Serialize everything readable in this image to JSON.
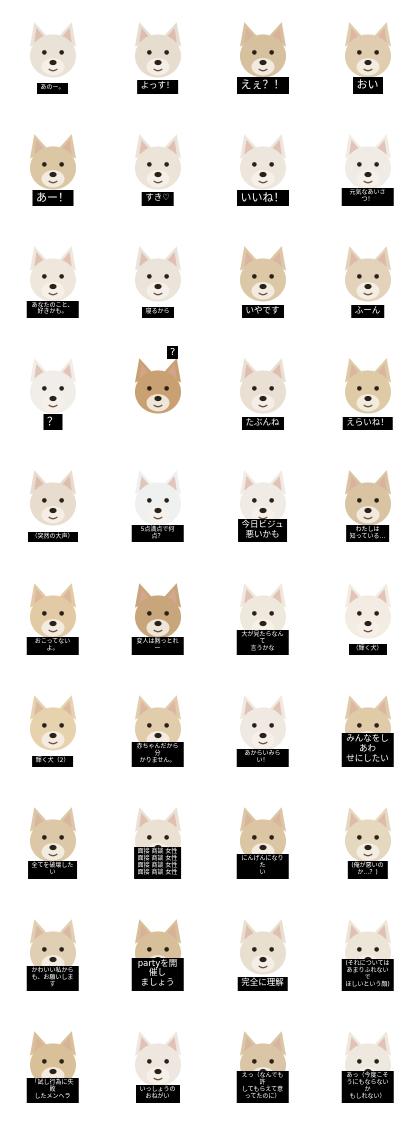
{
  "stickers": [
    {
      "caption": "あのー。",
      "size": "sm",
      "fur": "#e9e2d6"
    },
    {
      "caption": "よっす！",
      "size": "md",
      "fur": "#e7ddcf"
    },
    {
      "caption": "えぇ？！",
      "size": "lg",
      "fur": "#d7c09e"
    },
    {
      "caption": "おい",
      "size": "lg",
      "fur": "#e0cdb0"
    },
    {
      "caption": "あー！",
      "size": "lg",
      "fur": "#dcc7a4"
    },
    {
      "caption": "すき♡",
      "size": "md",
      "fur": "#ece4d8"
    },
    {
      "caption": "いいね！",
      "size": "lg",
      "fur": "#ede6dc"
    },
    {
      "caption": "元気なあいさつ！",
      "size": "sm",
      "fur": "#f0ece5"
    },
    {
      "caption": "あなたのこと、好きかも。",
      "size": "sm",
      "fur": "#efe7dc"
    },
    {
      "caption": "寝るから",
      "size": "sm",
      "fur": "#ebe4da"
    },
    {
      "caption": "いやです",
      "size": "md",
      "fur": "#dcc8a7"
    },
    {
      "caption": "ふーん",
      "size": "md",
      "fur": "#e4d3bb"
    },
    {
      "caption": "？",
      "size": "lg",
      "fur": "#f1eee9"
    },
    {
      "caption": "",
      "size": "sm",
      "fur": "#c9a072",
      "tag": "?"
    },
    {
      "caption": "たぶんね",
      "size": "md",
      "fur": "#e9dfd2"
    },
    {
      "caption": "えらいね！",
      "size": "md",
      "fur": "#dfcaa6"
    },
    {
      "caption": "（突然の大声）",
      "size": "sm",
      "fur": "#e7dccd"
    },
    {
      "caption": "5点満点で何点？",
      "size": "sm",
      "fur": "#eff0f0"
    },
    {
      "caption": "今日ビジュ\n悪いかも",
      "size": "md",
      "fur": "#f0ebe4"
    },
    {
      "caption": "わたしは\n知っている…",
      "size": "sm",
      "fur": "#d9c3a3"
    },
    {
      "caption": "おこってないよ。",
      "size": "sm",
      "fur": "#e2cba4"
    },
    {
      "caption": "変人は黙っとれー",
      "size": "sm",
      "fur": "#c8a57a"
    },
    {
      "caption": "大が見たらなんて\n言うかな",
      "size": "sm",
      "fur": "#efe8dd"
    },
    {
      "caption": "（輝く犬）",
      "size": "sm",
      "fur": "#f2ece2"
    },
    {
      "caption": "輝く犬（2）",
      "size": "sm",
      "fur": "#e7d2ae"
    },
    {
      "caption": "赤ちゃんだから 分\nかりません。",
      "size": "sm",
      "fur": "#e1ccac"
    },
    {
      "caption": "あからいみらい！",
      "size": "sm",
      "fur": "#efe9e1"
    },
    {
      "caption": "みんなをしあわ\nせにしたい",
      "size": "md",
      "fur": "#e0cba9"
    },
    {
      "caption": "全てを破壊した\nい",
      "size": "sm",
      "fur": "#dcc7a6"
    },
    {
      "caption": "面接 商談 女性\n面接 商談 女性\n面接 商談 女性\n面接 商談 女性",
      "size": "sm",
      "fur": "#ebe1d3"
    },
    {
      "caption": "にんげんになりた\nい",
      "size": "sm",
      "fur": "#dcc5a2"
    },
    {
      "caption": "(俺が悪いの\nか…？)",
      "size": "sm",
      "fur": "#e6d7bf"
    },
    {
      "caption": "かわいい私から\nも、お願いします",
      "size": "sm",
      "fur": "#e1cfb3"
    },
    {
      "caption": "partyを開催し\nましょう",
      "size": "md",
      "fur": "#d7bf99"
    },
    {
      "caption": "完全に理解",
      "size": "md",
      "fur": "#e9dfcf"
    },
    {
      "caption": "(それについては\nあまりふれないで\nほしいという顔)",
      "size": "sm",
      "fur": "#ede5d8"
    },
    {
      "caption": "「試し行為に失敗\nしたメンヘラ",
      "size": "sm",
      "fur": "#d9c099"
    },
    {
      "caption": "いっしょうの\nおねがい",
      "size": "sm",
      "fur": "#ede7df"
    },
    {
      "caption": "えっ（なんでも許\nしてもらえて意\nってたのに）",
      "size": "sm",
      "fur": "#dac6a6"
    },
    {
      "caption": "あっ（今度こそ\nうにもならないか\nもしれない）",
      "size": "sm",
      "fur": "#efe8de"
    }
  ]
}
